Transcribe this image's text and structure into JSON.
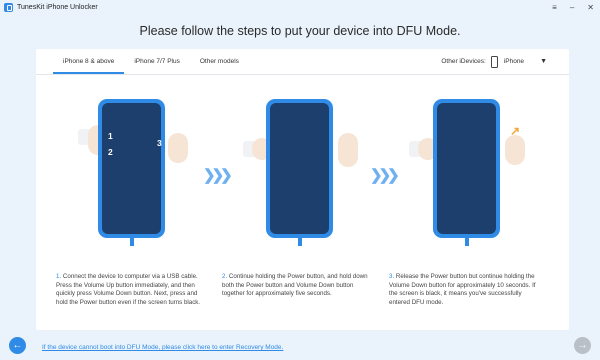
{
  "app": {
    "title": "TunesKit iPhone Unlocker"
  },
  "window_controls": {
    "menu": "≡",
    "minimize": "–",
    "close": "✕"
  },
  "heading": "Please follow the steps to put your device into DFU Mode.",
  "tabs": [
    {
      "label": "iPhone 8 & above",
      "active": true
    },
    {
      "label": "iPhone 7/7 Plus",
      "active": false
    },
    {
      "label": "Other models",
      "active": false
    }
  ],
  "device_selector": {
    "label": "Other iDevices:",
    "selected": "iPhone"
  },
  "steps": [
    {
      "number": "1.",
      "text": "Connect the device to computer via a USB cable. Press the Volume Up button immediately, and then quickly press Volume Down button. Next, press and hold the Power button even if the screen turns black."
    },
    {
      "number": "2.",
      "text": "Continue holding the Power button, and hold down both the Power button and Volume Down button together for approximately five seconds."
    },
    {
      "number": "3.",
      "text": "Release the Power button but continue holding the Volume Down button for approximately 10 seconds. If the screen is black, it means you've successfully entered DFU mode."
    }
  ],
  "phone_labels": [
    "1",
    "2",
    "3"
  ],
  "recovery_link": "If the device cannot boot into DFU Mode, please click here to enter Recovery Mode.",
  "colors": {
    "accent": "#2f8be6",
    "screen": "#1d3f6d",
    "background": "#eaf3fb"
  }
}
